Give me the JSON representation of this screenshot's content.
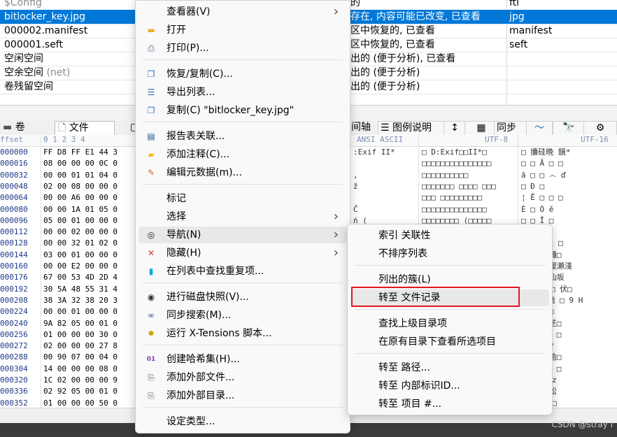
{
  "file_list": {
    "rows": [
      {
        "name": "$Config",
        "desc": "",
        "ext": "ftl",
        "selected": false,
        "grey_name": true
      },
      {
        "name": "bitlocker_key.jpg",
        "desc": "存在, 内容可能已改变, 已查看",
        "ext": "jpg",
        "selected": true,
        "grey_name": false
      },
      {
        "name": "000002.manifest",
        "desc": "区中恢复的, 已查看",
        "ext": "manifest",
        "selected": false,
        "grey_name": false
      },
      {
        "name": "000001.seft",
        "desc": "区中恢复的, 已查看",
        "ext": "seft",
        "selected": false,
        "grey_name": false
      },
      {
        "name": "空闲空间",
        "desc": "出的 (便于分析), 已查看",
        "ext": "",
        "selected": false,
        "grey_name": false
      },
      {
        "name": "空余空间",
        "name_suffix": "(net)",
        "desc": "出的 (便于分析)",
        "ext": "",
        "selected": false,
        "grey_name": false
      },
      {
        "name": "卷残留空间",
        "desc": "出的 (便于分析)",
        "ext": "",
        "selected": false,
        "grey_name": false
      }
    ],
    "row_top_desc": "的"
  },
  "tabs": {
    "volume": "卷",
    "file": "文件",
    "timeline": "间轴",
    "legend": "图例说明",
    "sync": "同步"
  },
  "hex": {
    "header": {
      "offset": "ffset",
      "cols": "0  1  2  3  4",
      "ansi": "ANSI ASCII",
      "utf8": "UTF-8",
      "utf16": "UTF-16"
    },
    "rows": [
      {
        "off": "000000",
        "bytes": "FF D8 FF E1 44 3",
        "ansi": ":Exif  II*",
        "utf8": "□    D:Exif□□II*□",
        "utf16": "□    攮硅晩   鏡*"
      },
      {
        "off": "000016",
        "bytes": "08 00 00 00 0C 0",
        "ansi": "",
        "utf8": "□□□□□□□□□□□□□□□",
        "utf16": "□   □ Ã □ □"
      },
      {
        "off": "000032",
        "bytes": "00 00 01 01 04 0",
        "ansi": "      ,",
        "utf8": "  □□□□□□□□□□",
        "utf16": "  ā □ □   ෴  ď"
      },
      {
        "off": "000048",
        "bytes": "02 00 08 00 00 0",
        "ansi": "ž",
        "utf8": "□□□□□□□   □□□□ □□□",
        "utf16": "  □        Ð □"
      },
      {
        "off": "000064",
        "bytes": "00 00 A6 00 00 0",
        "ansi": "",
        "utf8": "□□□   □□□□□□□□□",
        "utf16": "  ¦     Ē □ □ □"
      },
      {
        "off": "000080",
        "bytes": "00 00 1A 01 05 0",
        "ansi": "      Ĉ",
        "utf8": "□□□□□□□□□□□□□□",
        "utf16": "  Ė □   Ò   ě"
      },
      {
        "off": "000096",
        "bytes": "05 00 01 00 00 0",
        "ansi": "ń     (",
        "utf8": "□□□□□□□□    (□□□□□",
        "utf16": "  □ □   Î □"
      },
      {
        "off": "000112",
        "bytes": "00 00 02 00 00 0",
        "ansi": "",
        "utf8": "",
        "utf16": "  □ ı □     °"
      },
      {
        "off": "000128",
        "bytes": "00 00 32 01 02 0",
        "ansi": "",
        "utf8": "",
        "utf16": "  □ ı □ ¾ □"
      },
      {
        "off": "000144",
        "bytes": "03 00 01 00 00 0",
        "ansi": "",
        "utf8": "",
        "utf16": "  □ □ □ 蠅□"
      },
      {
        "off": "000160",
        "bytes": "00 00 E2 00 00 0",
        "ansi": "",
        "utf8": "",
        "utf16": "  â  ʃ □ 慳瀨淺"
      },
      {
        "off": "000176",
        "bytes": "67 00 53 4D 2D 4",
        "ansi": "",
        "utf8": "",
        "utf16": "□  □ □ 仙坂"
      },
      {
        "off": "000192",
        "bytes": "30 5A 48 55 31 4",
        "ansi": "",
        "utf8": "",
        "utf16": "□ 方稱 □ 伏□"
      },
      {
        "off": "000208",
        "bytes": "38 3A 32 38 20 3",
        "ansi": "",
        "utf8": "",
        "utf16": "□ ┐ 拈抛 □ 9 H"
      },
      {
        "off": "000224",
        "bytes": "00 00 01 00 00 0",
        "ansi": "",
        "utf8": "",
        "utf16": "  □  H □ □"
      },
      {
        "off": "000240",
        "bytes": "9A 82 05 00 01 0",
        "ansi": "",
        "utf8": "",
        "utf16": "  □  Φ □ 芝□"
      },
      {
        "off": "000256",
        "bytes": "01 00 00 00 30 0",
        "ansi": "",
        "utf8": "",
        "utf16": "  □ □ 蠢□ □"
      },
      {
        "off": "000272",
        "bytes": "02 00 00 00 27 8",
        "ansi": "",
        "utf8": "",
        "utf16": "  □ □ □ P"
      },
      {
        "off": "000288",
        "bytes": "00 90 07 00 04 0",
        "ansi": "",
        "utf8": "",
        "utf16": "  □ □ □ 逾□"
      },
      {
        "off": "000304",
        "bytes": "14 00 00 00 08 0",
        "ansi": "",
        "utf8": "",
        "utf16": "  □ □ 适□ □"
      },
      {
        "off": "000320",
        "bytes": "1C 02 00 00 00 9",
        "ansi": "",
        "utf8": "",
        "utf16": "  □拍□ □   z"
      },
      {
        "off": "000336",
        "bytes": "02 92 05 00 01 0",
        "ansi": "",
        "utf8": "",
        "utf16": "  □ □ ƒ 鈆"
      },
      {
        "off": "000352",
        "bytes": "01 00 00 00 50 0",
        "ansi": "",
        "utf8": "□□□□□□□□□",
        "utf16": "  □ □  斜 □"
      }
    ]
  },
  "context_menu": {
    "items": [
      {
        "id": "viewer",
        "label": "查看器(V)",
        "icon": "none",
        "submenu": true
      },
      {
        "id": "open",
        "label": "打开",
        "icon": "folder-icon",
        "submenu": false
      },
      {
        "id": "print",
        "label": "打印(P)...",
        "icon": "printer-icon",
        "submenu": false
      },
      {
        "id": "recover",
        "label": "恢复/复制(C)...",
        "icon": "copy-icon",
        "submenu": false
      },
      {
        "id": "export-list",
        "label": "导出列表...",
        "icon": "list-icon",
        "submenu": false
      },
      {
        "id": "copy-name",
        "label": "复制(C) \"bitlocker_key.jpg\"",
        "icon": "clipboard-icon",
        "submenu": false
      },
      {
        "id": "report",
        "label": "报告表关联...",
        "icon": "report-icon",
        "submenu": false
      },
      {
        "id": "comment",
        "label": "添加注释(C)...",
        "icon": "note-icon",
        "submenu": false
      },
      {
        "id": "metadata",
        "label": "编辑元数据(m)...",
        "icon": "pencil-icon",
        "submenu": false
      },
      {
        "id": "mark",
        "label": "标记",
        "icon": "none",
        "submenu": false
      },
      {
        "id": "select",
        "label": "选择",
        "icon": "none",
        "submenu": true
      },
      {
        "id": "navigate",
        "label": "导航(N)",
        "icon": "compass-icon",
        "submenu": true
      },
      {
        "id": "hide",
        "label": "隐藏(H)",
        "icon": "x-icon",
        "submenu": true
      },
      {
        "id": "find-dup",
        "label": "在列表中查找重复项...",
        "icon": "book-icon",
        "submenu": false
      },
      {
        "id": "snapshot",
        "label": "进行磁盘快照(V)...",
        "icon": "camera-icon",
        "submenu": false
      },
      {
        "id": "sync-search",
        "label": "同步搜索(M)...",
        "icon": "binoculars-icon",
        "submenu": false
      },
      {
        "id": "xtensions",
        "label": "运行 X-Tensions 脚本...",
        "icon": "gear-icon",
        "submenu": false
      },
      {
        "id": "hash-set",
        "label": "创建哈希集(H)...",
        "icon": "binary-icon",
        "submenu": false
      },
      {
        "id": "add-file",
        "label": "添加外部文件...",
        "icon": "paperclip-icon",
        "submenu": false
      },
      {
        "id": "add-dir",
        "label": "添加外部目录...",
        "icon": "paperclip-icon",
        "submenu": false
      },
      {
        "id": "set-type",
        "label": "设定类型...",
        "icon": "none",
        "submenu": false
      }
    ]
  },
  "nav_submenu": {
    "items": [
      {
        "id": "index-link",
        "label": "索引 关联性"
      },
      {
        "id": "unsorted",
        "label": "不排序列表"
      },
      {
        "id": "clusters",
        "label": "列出的簇(L)"
      },
      {
        "id": "goto-record",
        "label": "转至 文件记录"
      },
      {
        "id": "find-parent",
        "label": "查找上级目录项"
      },
      {
        "id": "view-in-dir",
        "label": "在原有目录下查看所选项目"
      },
      {
        "id": "goto-path",
        "label": "转至 路径..."
      },
      {
        "id": "goto-id",
        "label": "转至 内部标识ID..."
      },
      {
        "id": "goto-item",
        "label": "转至 项目 #..."
      }
    ]
  },
  "watermark": "CSDN @stray i",
  "colors": {
    "selection": "#0078d7",
    "highlight_box": "#e5161f",
    "offset_text": "#1f3a8a"
  }
}
